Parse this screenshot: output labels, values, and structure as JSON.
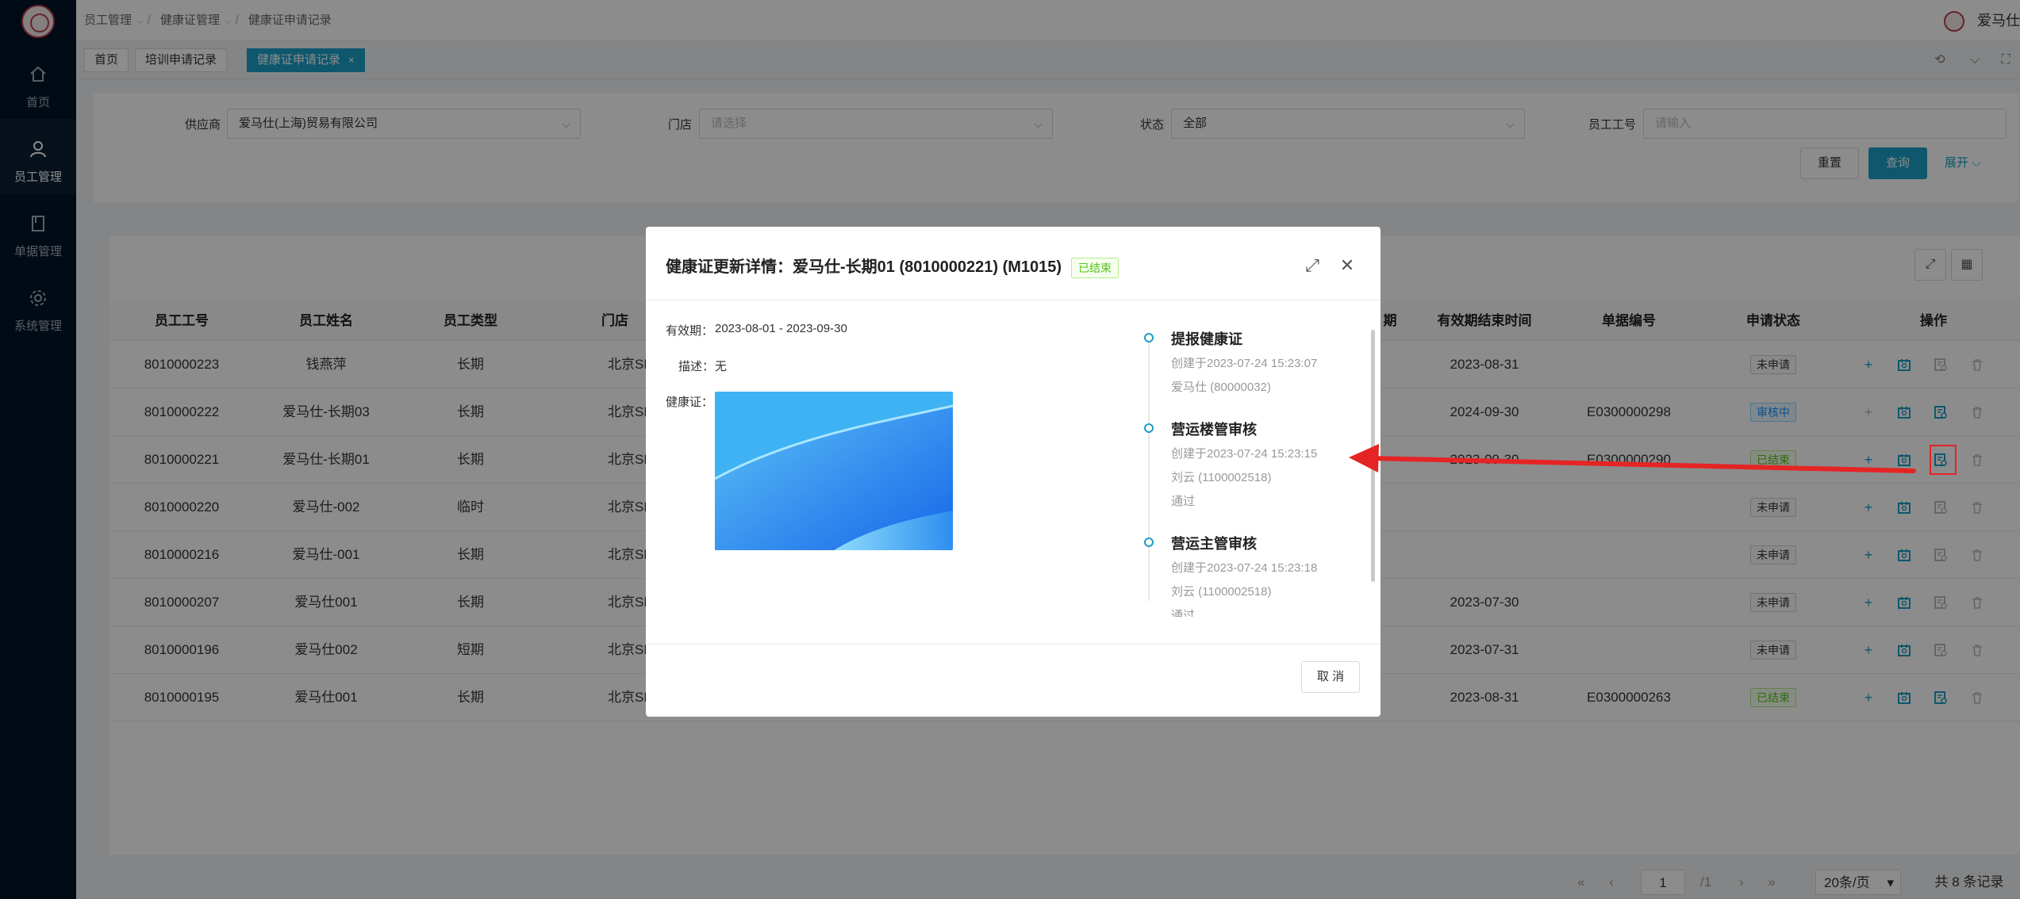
{
  "sidebar": {
    "items": [
      {
        "label": "首页",
        "icon": "home-icon"
      },
      {
        "label": "员工管理",
        "icon": "user-icon"
      },
      {
        "label": "单据管理",
        "icon": "document-icon"
      },
      {
        "label": "系统管理",
        "icon": "gear-icon"
      }
    ]
  },
  "header": {
    "breadcrumb": [
      "员工管理",
      "健康证管理",
      "健康证申请记录"
    ],
    "user_name": "爱马仕"
  },
  "tabs": [
    {
      "label": "首页"
    },
    {
      "label": "培训申请记录"
    },
    {
      "label": "健康证申请记录"
    }
  ],
  "filter": {
    "supplier_label": "供应商",
    "supplier_value": "爱马仕(上海)贸易有限公司",
    "store_label": "门店",
    "store_placeholder": "请选择",
    "status_label": "状态",
    "status_value": "全部",
    "empno_label": "员工工号",
    "empno_placeholder": "请输入",
    "reset": "重置",
    "query": "查询",
    "expand": "展开"
  },
  "table": {
    "headers": [
      "员工工号",
      "员工姓名",
      "员工类型",
      "门店",
      "期",
      "有效期结束时间",
      "单据编号",
      "申请状态",
      "操作"
    ],
    "rows": [
      {
        "no": "8010000223",
        "name": "钱燕萍",
        "type": "长期",
        "store": "北京SKP",
        "end": "2023-08-31",
        "doc": "",
        "status": "未申请"
      },
      {
        "no": "8010000222",
        "name": "爱马仕-长期03",
        "type": "长期",
        "store": "北京SKP",
        "end": "2024-09-30",
        "doc": "E0300000298",
        "status": "审核中"
      },
      {
        "no": "8010000221",
        "name": "爱马仕-长期01",
        "type": "长期",
        "store": "北京SKP",
        "end": "2023-09-30",
        "doc": "E0300000290",
        "status": "已结束"
      },
      {
        "no": "8010000220",
        "name": "爱马仕-002",
        "type": "临时",
        "store": "北京SKP",
        "end": "",
        "doc": "",
        "status": "未申请"
      },
      {
        "no": "8010000216",
        "name": "爱马仕-001",
        "type": "长期",
        "store": "北京SKP",
        "end": "",
        "doc": "",
        "status": "未申请"
      },
      {
        "no": "8010000207",
        "name": "爱马仕001",
        "type": "长期",
        "store": "北京SKP",
        "end": "2023-07-30",
        "doc": "",
        "status": "未申请"
      },
      {
        "no": "8010000196",
        "name": "爱马仕002",
        "type": "短期",
        "store": "北京SKP",
        "end": "2023-07-31",
        "doc": "",
        "status": "未申请"
      },
      {
        "no": "8010000195",
        "name": "爱马仕001",
        "type": "长期",
        "store": "北京SKP",
        "end": "2023-08-31",
        "doc": "E0300000263",
        "status": "已结束"
      }
    ]
  },
  "pager": {
    "page": "1",
    "total_pages": "/1",
    "page_size": "20条/页",
    "total": "共 8 条记录"
  },
  "modal": {
    "title": "健康证更新详情：爱马仕-长期01 (8010000221) (M1015)",
    "status": "已结束",
    "validity_label": "有效期：",
    "validity_value": "2023-08-01 - 2023-09-30",
    "desc_label": "描述：",
    "desc_value": "无",
    "cert_label": "健康证：",
    "timeline": [
      {
        "title": "提报健康证",
        "time": "创建于2023-07-24 15:23:07",
        "user": "爱马仕 (80000032)",
        "result": ""
      },
      {
        "title": "营运楼管审核",
        "time": "创建于2023-07-24 15:23:15",
        "user": "刘云 (1100002518)",
        "result": "通过"
      },
      {
        "title": "营运主管审核",
        "time": "创建于2023-07-24 15:23:18",
        "user": "刘云 (1100002518)",
        "result": "通过"
      }
    ],
    "cancel": "取 消"
  },
  "colors": {
    "primary": "#1a9ec7",
    "sidebar": "#001529",
    "success": "#52c41a",
    "annotation": "#e52424"
  }
}
